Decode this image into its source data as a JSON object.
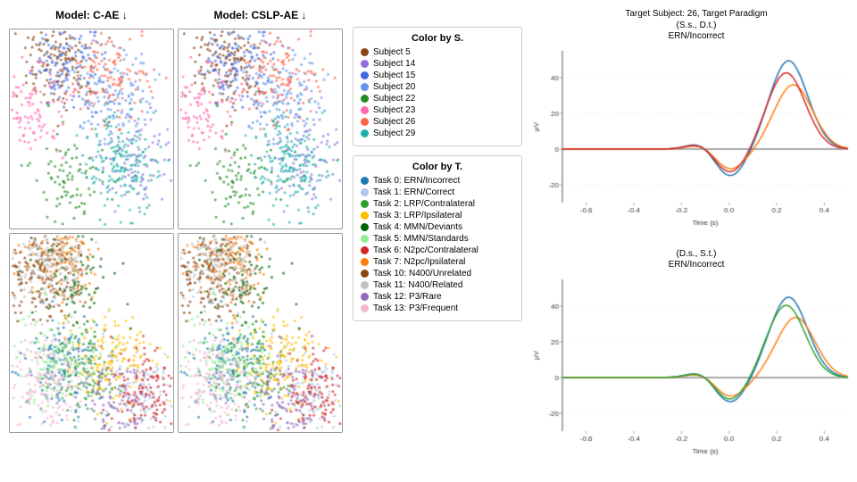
{
  "models": {
    "left_title": "Model: C-AE ↓",
    "right_title": "Model: CSLP-AE ↓"
  },
  "legend_subjects": {
    "title": "Color by S.",
    "items": [
      {
        "label": "Subject 5",
        "color": "#8B4513"
      },
      {
        "label": "Subject 14",
        "color": "#9370DB"
      },
      {
        "label": "Subject 15",
        "color": "#4169E1"
      },
      {
        "label": "Subject 20",
        "color": "#6495ED"
      },
      {
        "label": "Subject 22",
        "color": "#228B22"
      },
      {
        "label": "Subject 23",
        "color": "#FF69B4"
      },
      {
        "label": "Subject 26",
        "color": "#FF6347"
      },
      {
        "label": "Subject 29",
        "color": "#20B2AA"
      }
    ]
  },
  "legend_tasks": {
    "title": "Color by T.",
    "items": [
      {
        "label": "Task 0: ERN/Incorrect",
        "color": "#1f77b4"
      },
      {
        "label": "Task 1: ERN/Correct",
        "color": "#aec7e8"
      },
      {
        "label": "Task 2: LRP/Contralateral",
        "color": "#2ca02c"
      },
      {
        "label": "Task 3: LRP/Ipsilateral",
        "color": "#FFBF00"
      },
      {
        "label": "Task 4: MMN/Deviants",
        "color": "#006400"
      },
      {
        "label": "Task 5: MMN/Standards",
        "color": "#90EE90"
      },
      {
        "label": "Task 6: N2pc/Contralateral",
        "color": "#d62728"
      },
      {
        "label": "Task 7: N2pc/Ipsilateral",
        "color": "#ff7f0e"
      },
      {
        "label": "Task 10: N400/Unrelated",
        "color": "#8B4513"
      },
      {
        "label": "Task 11: N400/Related",
        "color": "#C0C0C0"
      },
      {
        "label": "Task 12: P3/Rare",
        "color": "#9467bd"
      },
      {
        "label": "Task 13: P3/Frequent",
        "color": "#f7b6d2"
      }
    ]
  },
  "erp": {
    "header": "Target Subject: 26, Target Paradigm",
    "top_subtitle_line1": "(S.s., D.t.)",
    "top_subtitle_line2": "ERN/Incorrect",
    "bottom_subtitle_line1": "(D.s., S.t.)",
    "bottom_subtitle_line2": "ERN/Incorrect",
    "y_label": "μV",
    "x_ticks": [
      "-0.6",
      "-0.4",
      "-0.2",
      "0.0",
      "0.2",
      "0.4"
    ],
    "x_label": "Time (s)"
  }
}
